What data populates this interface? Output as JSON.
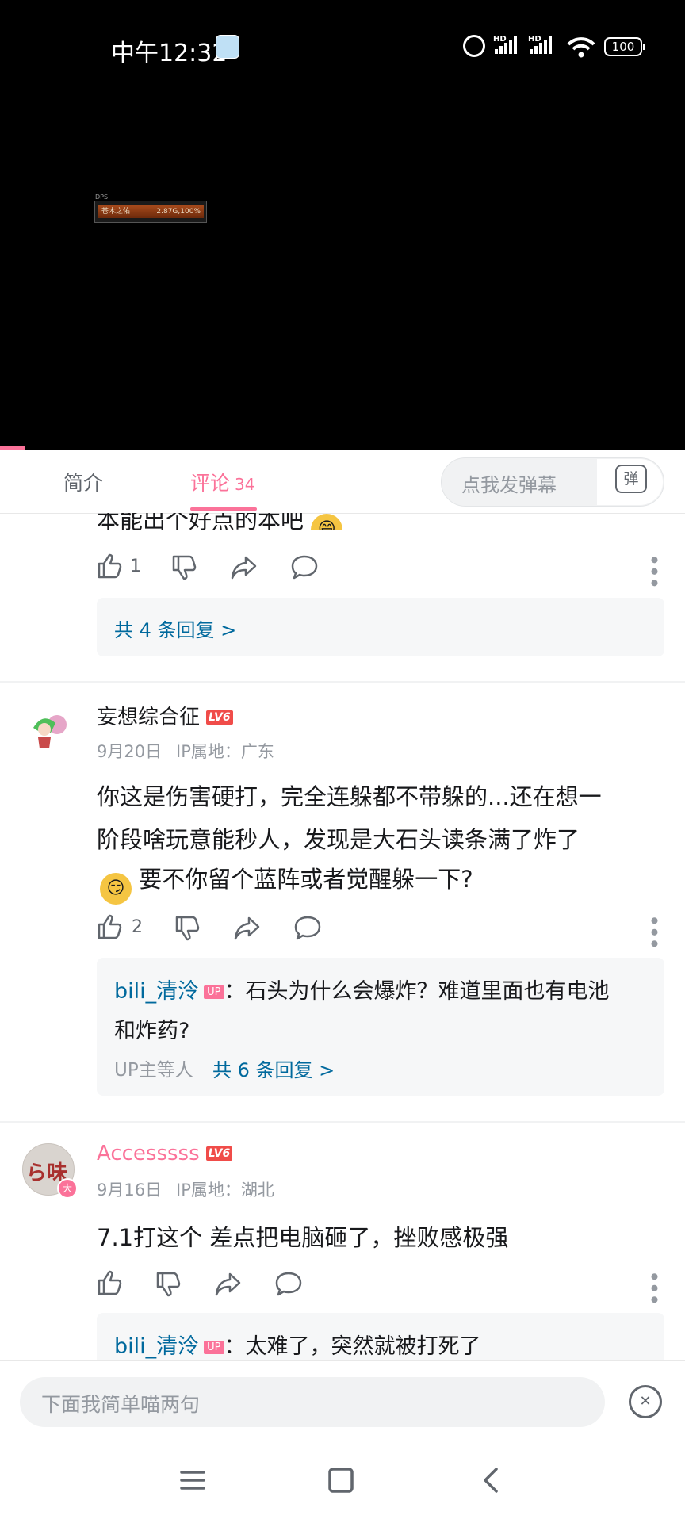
{
  "status_bar": {
    "time": "中午12:32",
    "hd1": "HD",
    "hd2": "HD",
    "battery": "100"
  },
  "video": {
    "dps_header": "DPS",
    "dps_name": "苍木之佑",
    "dps_value": "2.87G,100%"
  },
  "tabs": {
    "intro": "简介",
    "comments": "评论",
    "comments_count": "34",
    "danmaku_placeholder": "点我发弹幕",
    "danmaku_icon": "弹"
  },
  "comments": [
    {
      "partial_text": "本能出个好点的本吧",
      "likes": "1",
      "reply_summary": "共 4 条回复 >"
    },
    {
      "username": "妄想综合征",
      "level": "LV6",
      "date": "9月20日",
      "ip": "IP属地：广东",
      "text_line1": "你这是伤害硬打，完全连躲都不带躲的...还在想一",
      "text_line2": "阶段啥玩意能秒人，发现是大石头读条满了炸了",
      "text_line3": "要不你留个蓝阵或者觉醒躲一下?",
      "likes": "2",
      "reply_user": "bili_清泠",
      "reply_badge": "UP",
      "reply_text_line1": "：石头为什么会爆炸？难道里面也有电池",
      "reply_text_line2": "和炸药?",
      "reply_extra": "UP主等人",
      "reply_summary": "共 6 条回复 >"
    },
    {
      "username": "Accesssss",
      "level": "LV6",
      "date": "9月16日",
      "ip": "IP属地：湖北",
      "text": "7.1打这个 差点把电脑砸了，挫败感极强",
      "reply_user": "bili_清泠",
      "reply_badge": "UP",
      "reply_text": "：太难了，突然就被打死了"
    }
  ],
  "bottom": {
    "input_placeholder": "下面我简单喵两句"
  },
  "colors": {
    "accent": "#fb7299",
    "link": "#00699d",
    "level_badge": "#f04c49"
  }
}
